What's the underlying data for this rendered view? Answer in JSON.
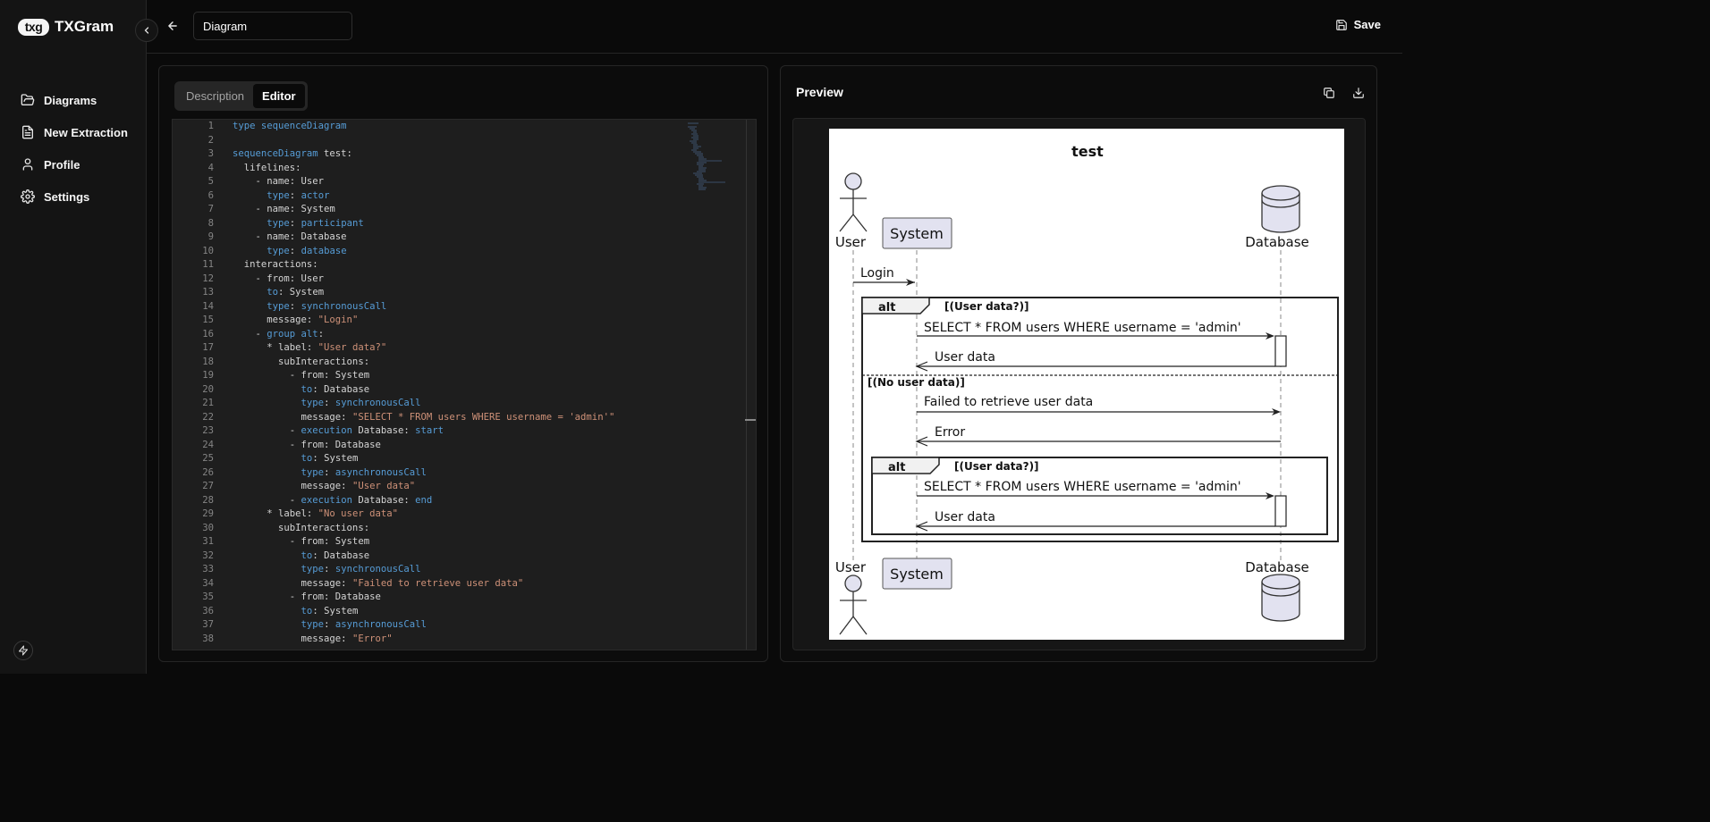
{
  "app": {
    "logo_mark": "txg",
    "name": "TXGram"
  },
  "sidebar": {
    "items": [
      {
        "label": "Diagrams",
        "icon": "folder-open-icon"
      },
      {
        "label": "New Extraction",
        "icon": "file-text-icon"
      },
      {
        "label": "Profile",
        "icon": "user-icon"
      },
      {
        "label": "Settings",
        "icon": "gear-icon"
      }
    ],
    "footer_icon": "bolt-icon"
  },
  "topbar": {
    "title_value": "Diagram",
    "save_label": "Save"
  },
  "editor_panel": {
    "tabs": [
      {
        "label": "Description",
        "active": false
      },
      {
        "label": "Editor",
        "active": true
      }
    ],
    "code_lines": [
      [
        [
          "kw",
          "type sequenceDiagram"
        ]
      ],
      [],
      [
        [
          "kw",
          "sequenceDiagram"
        ],
        [
          "t",
          " test:"
        ]
      ],
      [
        [
          "t",
          "  lifelines:"
        ]
      ],
      [
        [
          "t",
          "    - name: User"
        ]
      ],
      [
        [
          "t",
          "      "
        ],
        [
          "kw",
          "type"
        ],
        [
          "t",
          ": "
        ],
        [
          "kw",
          "actor"
        ]
      ],
      [
        [
          "t",
          "    - name: System"
        ]
      ],
      [
        [
          "t",
          "      "
        ],
        [
          "kw",
          "type"
        ],
        [
          "t",
          ": "
        ],
        [
          "kw",
          "participant"
        ]
      ],
      [
        [
          "t",
          "    - name: Database"
        ]
      ],
      [
        [
          "t",
          "      "
        ],
        [
          "kw",
          "type"
        ],
        [
          "t",
          ": "
        ],
        [
          "kw",
          "database"
        ]
      ],
      [
        [
          "t",
          "  interactions:"
        ]
      ],
      [
        [
          "t",
          "    - from: User"
        ]
      ],
      [
        [
          "t",
          "      "
        ],
        [
          "kw",
          "to"
        ],
        [
          "t",
          ": System"
        ]
      ],
      [
        [
          "t",
          "      "
        ],
        [
          "kw",
          "type"
        ],
        [
          "t",
          ": "
        ],
        [
          "kw",
          "synchronousCall"
        ]
      ],
      [
        [
          "t",
          "      message: "
        ],
        [
          "str",
          "\"Login\""
        ]
      ],
      [
        [
          "t",
          "    - "
        ],
        [
          "kw",
          "group alt"
        ],
        [
          "t",
          ":"
        ]
      ],
      [
        [
          "t",
          "      * label: "
        ],
        [
          "str",
          "\"User data?\""
        ]
      ],
      [
        [
          "t",
          "        subInteractions:"
        ]
      ],
      [
        [
          "t",
          "          - from: System"
        ]
      ],
      [
        [
          "t",
          "            "
        ],
        [
          "kw",
          "to"
        ],
        [
          "t",
          ": Database"
        ]
      ],
      [
        [
          "t",
          "            "
        ],
        [
          "kw",
          "type"
        ],
        [
          "t",
          ": "
        ],
        [
          "kw",
          "synchronousCall"
        ]
      ],
      [
        [
          "t",
          "            message: "
        ],
        [
          "str",
          "\"SELECT * FROM users WHERE username = 'admin'\""
        ]
      ],
      [
        [
          "t",
          "          - "
        ],
        [
          "kw",
          "execution"
        ],
        [
          "t",
          " Database: "
        ],
        [
          "kw",
          "start"
        ]
      ],
      [
        [
          "t",
          "          - from: Database"
        ]
      ],
      [
        [
          "t",
          "            "
        ],
        [
          "kw",
          "to"
        ],
        [
          "t",
          ": System"
        ]
      ],
      [
        [
          "t",
          "            "
        ],
        [
          "kw",
          "type"
        ],
        [
          "t",
          ": "
        ],
        [
          "kw",
          "asynchronousCall"
        ]
      ],
      [
        [
          "t",
          "            message: "
        ],
        [
          "str",
          "\"User data\""
        ]
      ],
      [
        [
          "t",
          "          - "
        ],
        [
          "kw",
          "execution"
        ],
        [
          "t",
          " Database: "
        ],
        [
          "kw",
          "end"
        ]
      ],
      [
        [
          "t",
          "      * label: "
        ],
        [
          "str",
          "\"No user data\""
        ]
      ],
      [
        [
          "t",
          "        subInteractions:"
        ]
      ],
      [
        [
          "t",
          "          - from: System"
        ]
      ],
      [
        [
          "t",
          "            "
        ],
        [
          "kw",
          "to"
        ],
        [
          "t",
          ": Database"
        ]
      ],
      [
        [
          "t",
          "            "
        ],
        [
          "kw",
          "type"
        ],
        [
          "t",
          ": "
        ],
        [
          "kw",
          "synchronousCall"
        ]
      ],
      [
        [
          "t",
          "            message: "
        ],
        [
          "str",
          "\"Failed to retrieve user data\""
        ]
      ],
      [
        [
          "t",
          "          - from: Database"
        ]
      ],
      [
        [
          "t",
          "            "
        ],
        [
          "kw",
          "to"
        ],
        [
          "t",
          ": System"
        ]
      ],
      [
        [
          "t",
          "            "
        ],
        [
          "kw",
          "type"
        ],
        [
          "t",
          ": "
        ],
        [
          "kw",
          "asynchronousCall"
        ]
      ],
      [
        [
          "t",
          "            message: "
        ],
        [
          "str",
          "\"Error\""
        ]
      ]
    ]
  },
  "preview": {
    "title": "Preview",
    "diagram": {
      "title": "test",
      "participants": [
        "User",
        "System",
        "Database"
      ],
      "messages": {
        "login": "Login",
        "select1": "SELECT * FROM users WHERE username = 'admin'",
        "userdata1": "User data",
        "failed": "Failed to retrieve user data",
        "error": "Error",
        "select2": "SELECT * FROM users WHERE username = 'admin'",
        "userdata2": "User data"
      },
      "frames": {
        "alt_outer": "alt",
        "alt_outer_guard": "[(User data?)]",
        "else_guard": "[(No user data)]",
        "alt_inner": "alt",
        "alt_inner_guard": "[(User data?)]"
      }
    }
  }
}
